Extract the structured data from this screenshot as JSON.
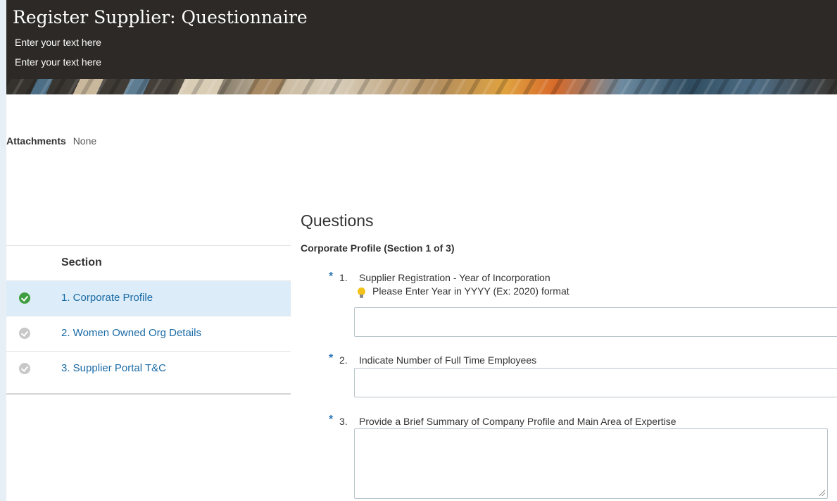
{
  "header": {
    "title": "Register Supplier: Questionnaire",
    "line1": "Enter your text here",
    "line2": "Enter your text here"
  },
  "attachments": {
    "label": "Attachments",
    "value": "None"
  },
  "sections": {
    "header": "Section",
    "items": [
      {
        "label": "1. Corporate Profile",
        "status": "complete",
        "active": true
      },
      {
        "label": "2. Women Owned Org Details",
        "status": "incomplete",
        "active": false
      },
      {
        "label": "3. Supplier Portal T&C",
        "status": "incomplete",
        "active": false
      }
    ]
  },
  "questions": {
    "title": "Questions",
    "section_heading": "Corporate Profile (Section 1 of 3)",
    "required_marker": "*",
    "items": [
      {
        "number": "1.",
        "text": "Supplier Registration - Year of Incorporation",
        "hint": "Please Enter Year in YYYY (Ex: 2020) format",
        "value": ""
      },
      {
        "number": "2.",
        "text": "Indicate Number of Full Time Employees",
        "value": ""
      },
      {
        "number": "3.",
        "text": "Provide a Brief Summary of Company Profile and Main Area of Expertise",
        "value": ""
      }
    ]
  },
  "colors": {
    "header_bg": "#2c2926",
    "link": "#1a6ba6",
    "active_row": "#dcecf8",
    "required_star": "#2e78b7",
    "check_complete": "#3f9e3f",
    "check_incomplete": "#c8c8c8",
    "hint_icon": "#f3c31b"
  }
}
